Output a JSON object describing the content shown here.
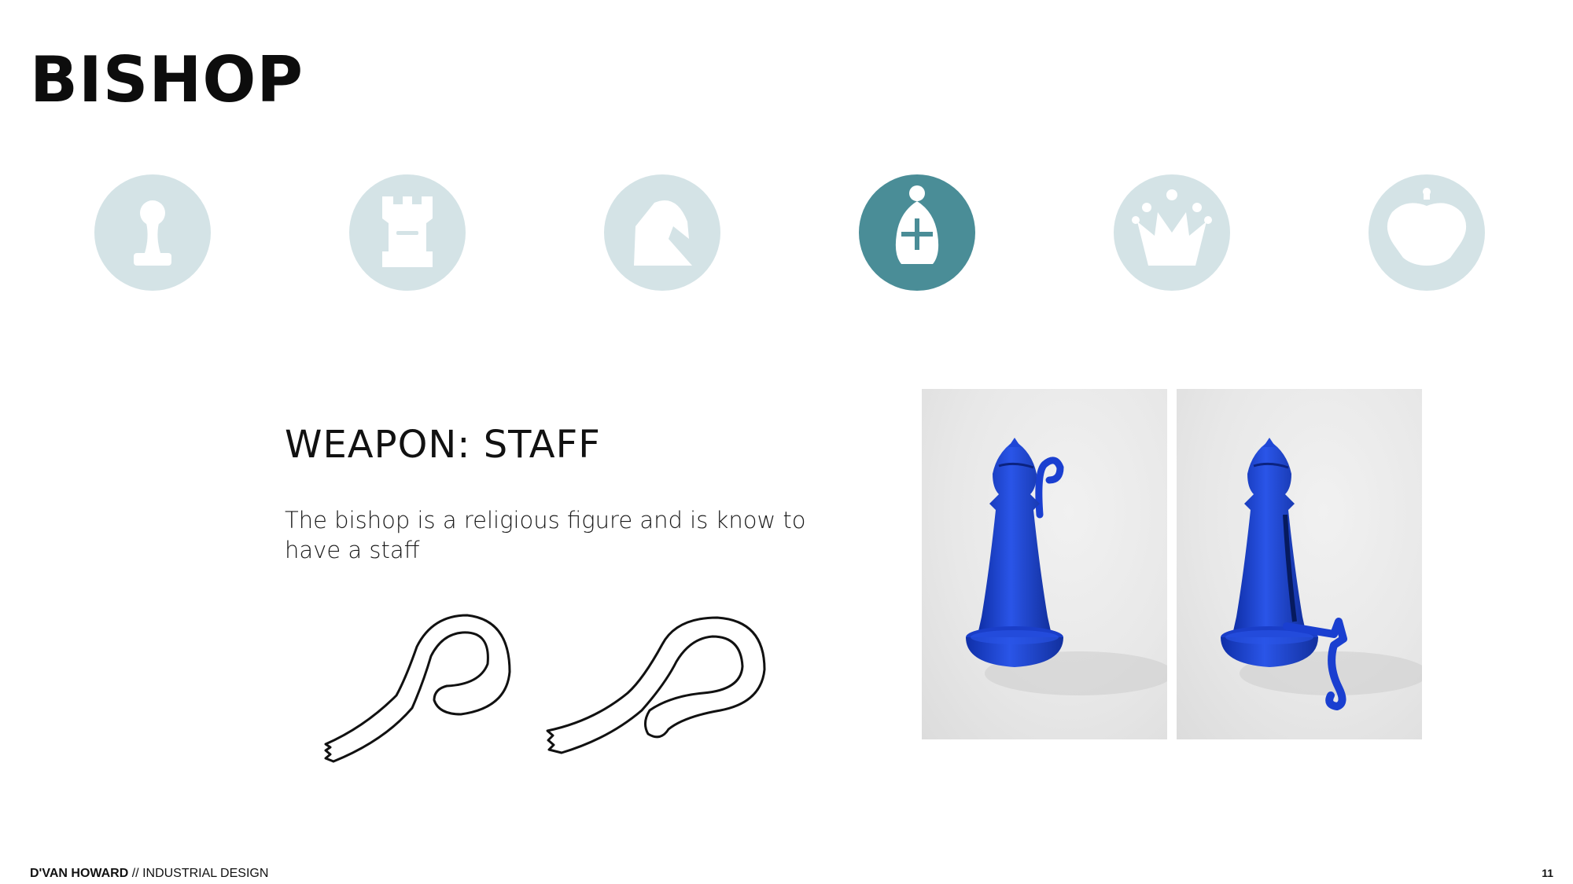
{
  "title": "BISHOP",
  "pieces": [
    {
      "name": "pawn",
      "icon": "pawn-icon",
      "active": false
    },
    {
      "name": "rook",
      "icon": "rook-icon",
      "active": false
    },
    {
      "name": "knight",
      "icon": "knight-icon",
      "active": false
    },
    {
      "name": "bishop",
      "icon": "bishop-icon",
      "active": true
    },
    {
      "name": "queen",
      "icon": "queen-icon",
      "active": false
    },
    {
      "name": "king",
      "icon": "king-icon",
      "active": false
    }
  ],
  "colors": {
    "icon_inactive": "#d4e3e6",
    "icon_active": "#4a8d97",
    "render_blue": "#1f47d6"
  },
  "section": {
    "heading": "WEAPON: STAFF",
    "body": "The bishop is a religious figure and is know to have a staff"
  },
  "sketches": [
    {
      "subject": "staff-sketch-1"
    },
    {
      "subject": "staff-sketch-2"
    }
  ],
  "renders": [
    {
      "subject": "bishop-render-staff-raised"
    },
    {
      "subject": "bishop-render-staff-lowered"
    }
  ],
  "footer": {
    "author": "D'VAN HOWARD",
    "separator": " // ",
    "discipline": "INDUSTRIAL DESIGN",
    "page_number": "11"
  }
}
